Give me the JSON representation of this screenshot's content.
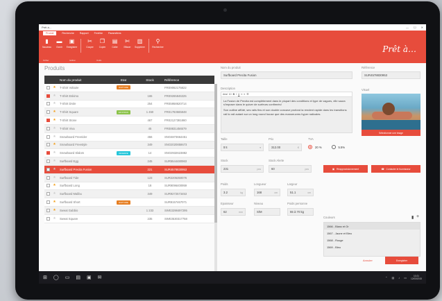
{
  "window": {
    "title": "Prêt à…",
    "controls": [
      "—",
      "☐",
      "✕"
    ]
  },
  "ribbon": {
    "tabs": [
      "Produit",
      "Recherche",
      "Rapport",
      "Fenêtre",
      "Paramètres"
    ],
    "tools": [
      {
        "icon": "new-icon",
        "glyph": "▮",
        "label": "Nouveau"
      },
      {
        "icon": "folder-icon",
        "glyph": "▬",
        "label": "Ouvrir"
      },
      {
        "icon": "save-icon",
        "glyph": "▣",
        "label": "Enregistrer"
      },
      {
        "icon": "cut-icon",
        "glyph": "✂",
        "label": "Couper"
      },
      {
        "icon": "copy-icon",
        "glyph": "❐",
        "label": "Copier"
      },
      {
        "icon": "paste-icon",
        "glyph": "▤",
        "label": "Coller"
      },
      {
        "icon": "scissors-icon",
        "glyph": "✄",
        "label": "Effacer"
      },
      {
        "icon": "trash-icon",
        "glyph": "▥",
        "label": "Supprimer"
      },
      {
        "icon": "search-icon",
        "glyph": "⚲",
        "label": "Rechercher"
      }
    ],
    "groups": [
      "Fichier",
      "Edition",
      "Outils"
    ],
    "brand": "Prêt à…"
  },
  "products": {
    "title": "Produits",
    "columns": [
      "Nom du produit",
      "Etat",
      "Stock",
      "Référence"
    ],
    "rows": [
      {
        "checked": false,
        "star": true,
        "name": "T-Shirt Voltaire",
        "badge": "RUPTURE",
        "badge_color": "#e67e22",
        "stock": "",
        "ref": "FRE9062175822"
      },
      {
        "checked": true,
        "star": false,
        "name": "T-Shirt Eskimo",
        "badge": "",
        "badge_color": "",
        "stock": "165",
        "ref": "FRE9265846325"
      },
      {
        "checked": false,
        "star": false,
        "name": "T-Shirt Drole",
        "badge": "",
        "badge_color": "",
        "stock": "254",
        "ref": "FRE5958620714"
      },
      {
        "checked": false,
        "star": true,
        "name": "T-Shirt Square",
        "badge": "EN STOCK",
        "badge_color": "#8bc34a",
        "stock": "1 450",
        "ref": "FRE1783565848"
      },
      {
        "checked": true,
        "star": true,
        "name": "T-Shirt Stone",
        "badge": "",
        "badge_color": "",
        "stock": "467",
        "ref": "FRE2127381860"
      },
      {
        "checked": false,
        "star": false,
        "name": "T-Shirt Viva",
        "badge": "",
        "badge_color": "",
        "stock": "45",
        "ref": "FRE8831456579"
      },
      {
        "checked": false,
        "star": false,
        "name": "Snowboard Freerider",
        "badge": "",
        "badge_color": "",
        "stock": "456",
        "ref": "SNO4873664451"
      },
      {
        "checked": false,
        "star": true,
        "name": "Snowboard Freestyle",
        "badge": "",
        "badge_color": "",
        "stock": "349",
        "ref": "SNO2020858673"
      },
      {
        "checked": true,
        "star": false,
        "name": "Snowboard Slalom",
        "badge": "RESERVE",
        "badge_color": "#26c6da",
        "stock": "14",
        "ref": "SNO2932623882"
      },
      {
        "checked": false,
        "star": false,
        "name": "Surfboard Egg",
        "badge": "",
        "badge_color": "",
        "stock": "245",
        "ref": "SUR5544480963"
      },
      {
        "checked": false,
        "star": false,
        "name": "Surfboard Precita Fusion",
        "badge": "",
        "badge_color": "",
        "stock": "221",
        "ref": "SUR4578830953",
        "selected": true
      },
      {
        "checked": false,
        "star": false,
        "name": "Surfboard Tide",
        "badge": "",
        "badge_color": "",
        "stock": "123",
        "ref": "SUR2205350076"
      },
      {
        "checked": false,
        "star": true,
        "name": "Surfboard Long",
        "badge": "",
        "badge_color": "",
        "stock": "18",
        "ref": "SUR9096400959"
      },
      {
        "checked": false,
        "star": false,
        "name": "Surfboard Malibu",
        "badge": "",
        "badge_color": "",
        "stock": "349",
        "ref": "SUR9272573453"
      },
      {
        "checked": false,
        "star": true,
        "name": "Surfboard Short",
        "badge": "RUPTURE",
        "badge_color": "#e67e22",
        "stock": "",
        "ref": "SUR8157467071"
      },
      {
        "checked": false,
        "star": true,
        "name": "Sweat Gabbio",
        "badge": "",
        "badge_color": "",
        "stock": "1 233",
        "ref": "SWE3298497295"
      },
      {
        "checked": false,
        "star": false,
        "name": "Sweat Square",
        "badge": "",
        "badge_color": "",
        "stock": "235",
        "ref": "SWE3530317758"
      }
    ]
  },
  "detail": {
    "name_label": "Nom du produit",
    "name_value": "Surfboard Precita Fusion",
    "ref_label": "Référence",
    "ref_value": "SUR4578830953",
    "desc_label": "Description",
    "editor_font": "Arial",
    "editor_size": "10",
    "desc_p1": "La Fusion de Precita est complètement dans le plupart des conditions et type de vagues, elle saura s'imposer dans le quiver de surfeurs confirmés!",
    "desc_p2": "Son outline affûté, ses rails fins et son double concave profond la rendent rapide dans les transitions rail to rail autant sur un long round house que des manoeuvres hyper radicales.",
    "visual_label": "Visuel",
    "change_image": "Sélectionner une image",
    "size_label": "Taille",
    "size_value": "5'4",
    "price_label": "Prix",
    "price_value": "312.00",
    "price_unit": "€",
    "tva_label": "TVA",
    "tva_options": [
      "20 %",
      "5.5%"
    ],
    "stock_label": "Stock",
    "stock_value": "231",
    "stock_unit": "pcs",
    "min_stock_label": "Stock Alerte",
    "min_stock_value": "60",
    "min_stock_unit": "pcs",
    "btn_restock": "Réapprovisionnement",
    "btn_supplier": "Contacter le fournisseur",
    "weight_label": "Poids",
    "weight_value": "3.2",
    "weight_unit": "kg",
    "length_label": "Longueur",
    "length_value": "168",
    "length_unit": "cm",
    "width_label": "Largeur",
    "width_value": "51.1",
    "width_unit": "cm",
    "thickness_label": "Epaisseur",
    "thickness_value": "62",
    "thickness_unit": "mm",
    "level_label": "Niveau",
    "level_value": "S/M",
    "person_weight_label": "Poids personne",
    "person_weight_value": "55 à 70 kg",
    "colors_label": "Couleurs",
    "colors": [
      "1566 - Blanc et Or",
      "1567 - Jaune et Bleu",
      "1568 - Rouge",
      "1569 - Bleu"
    ],
    "cancel": "Annuler",
    "save": "Enregistrer"
  },
  "taskbar": {
    "time": "10:21",
    "date": "12/03/2015"
  },
  "colors": {
    "accent": "#e74c3c",
    "dark": "#3a3a3a"
  }
}
